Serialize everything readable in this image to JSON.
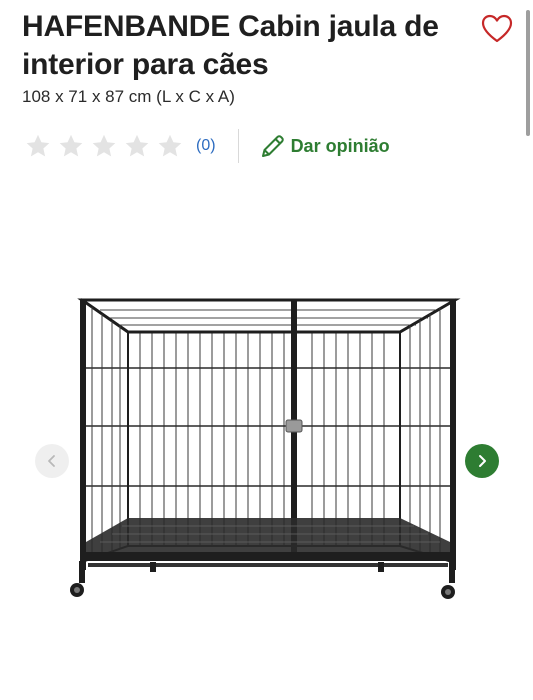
{
  "product": {
    "title": "HAFENBANDE Cabin jaula de interior para cães",
    "dimensions": "108 x 71 x 87 cm (L x C x A)"
  },
  "rating": {
    "stars_filled": 0,
    "stars_total": 5,
    "review_count": "(0)",
    "write_review_label": "Dar opinião"
  },
  "icons": {
    "favorite": "heart-outline-icon",
    "write_review": "pencil-icon",
    "prev": "chevron-left-icon",
    "next": "chevron-right-icon"
  },
  "colors": {
    "accent_green": "#2e7d32",
    "favorite_red": "#c62828",
    "link_blue": "#2d6cc0",
    "star_empty": "#e3e3e3"
  }
}
